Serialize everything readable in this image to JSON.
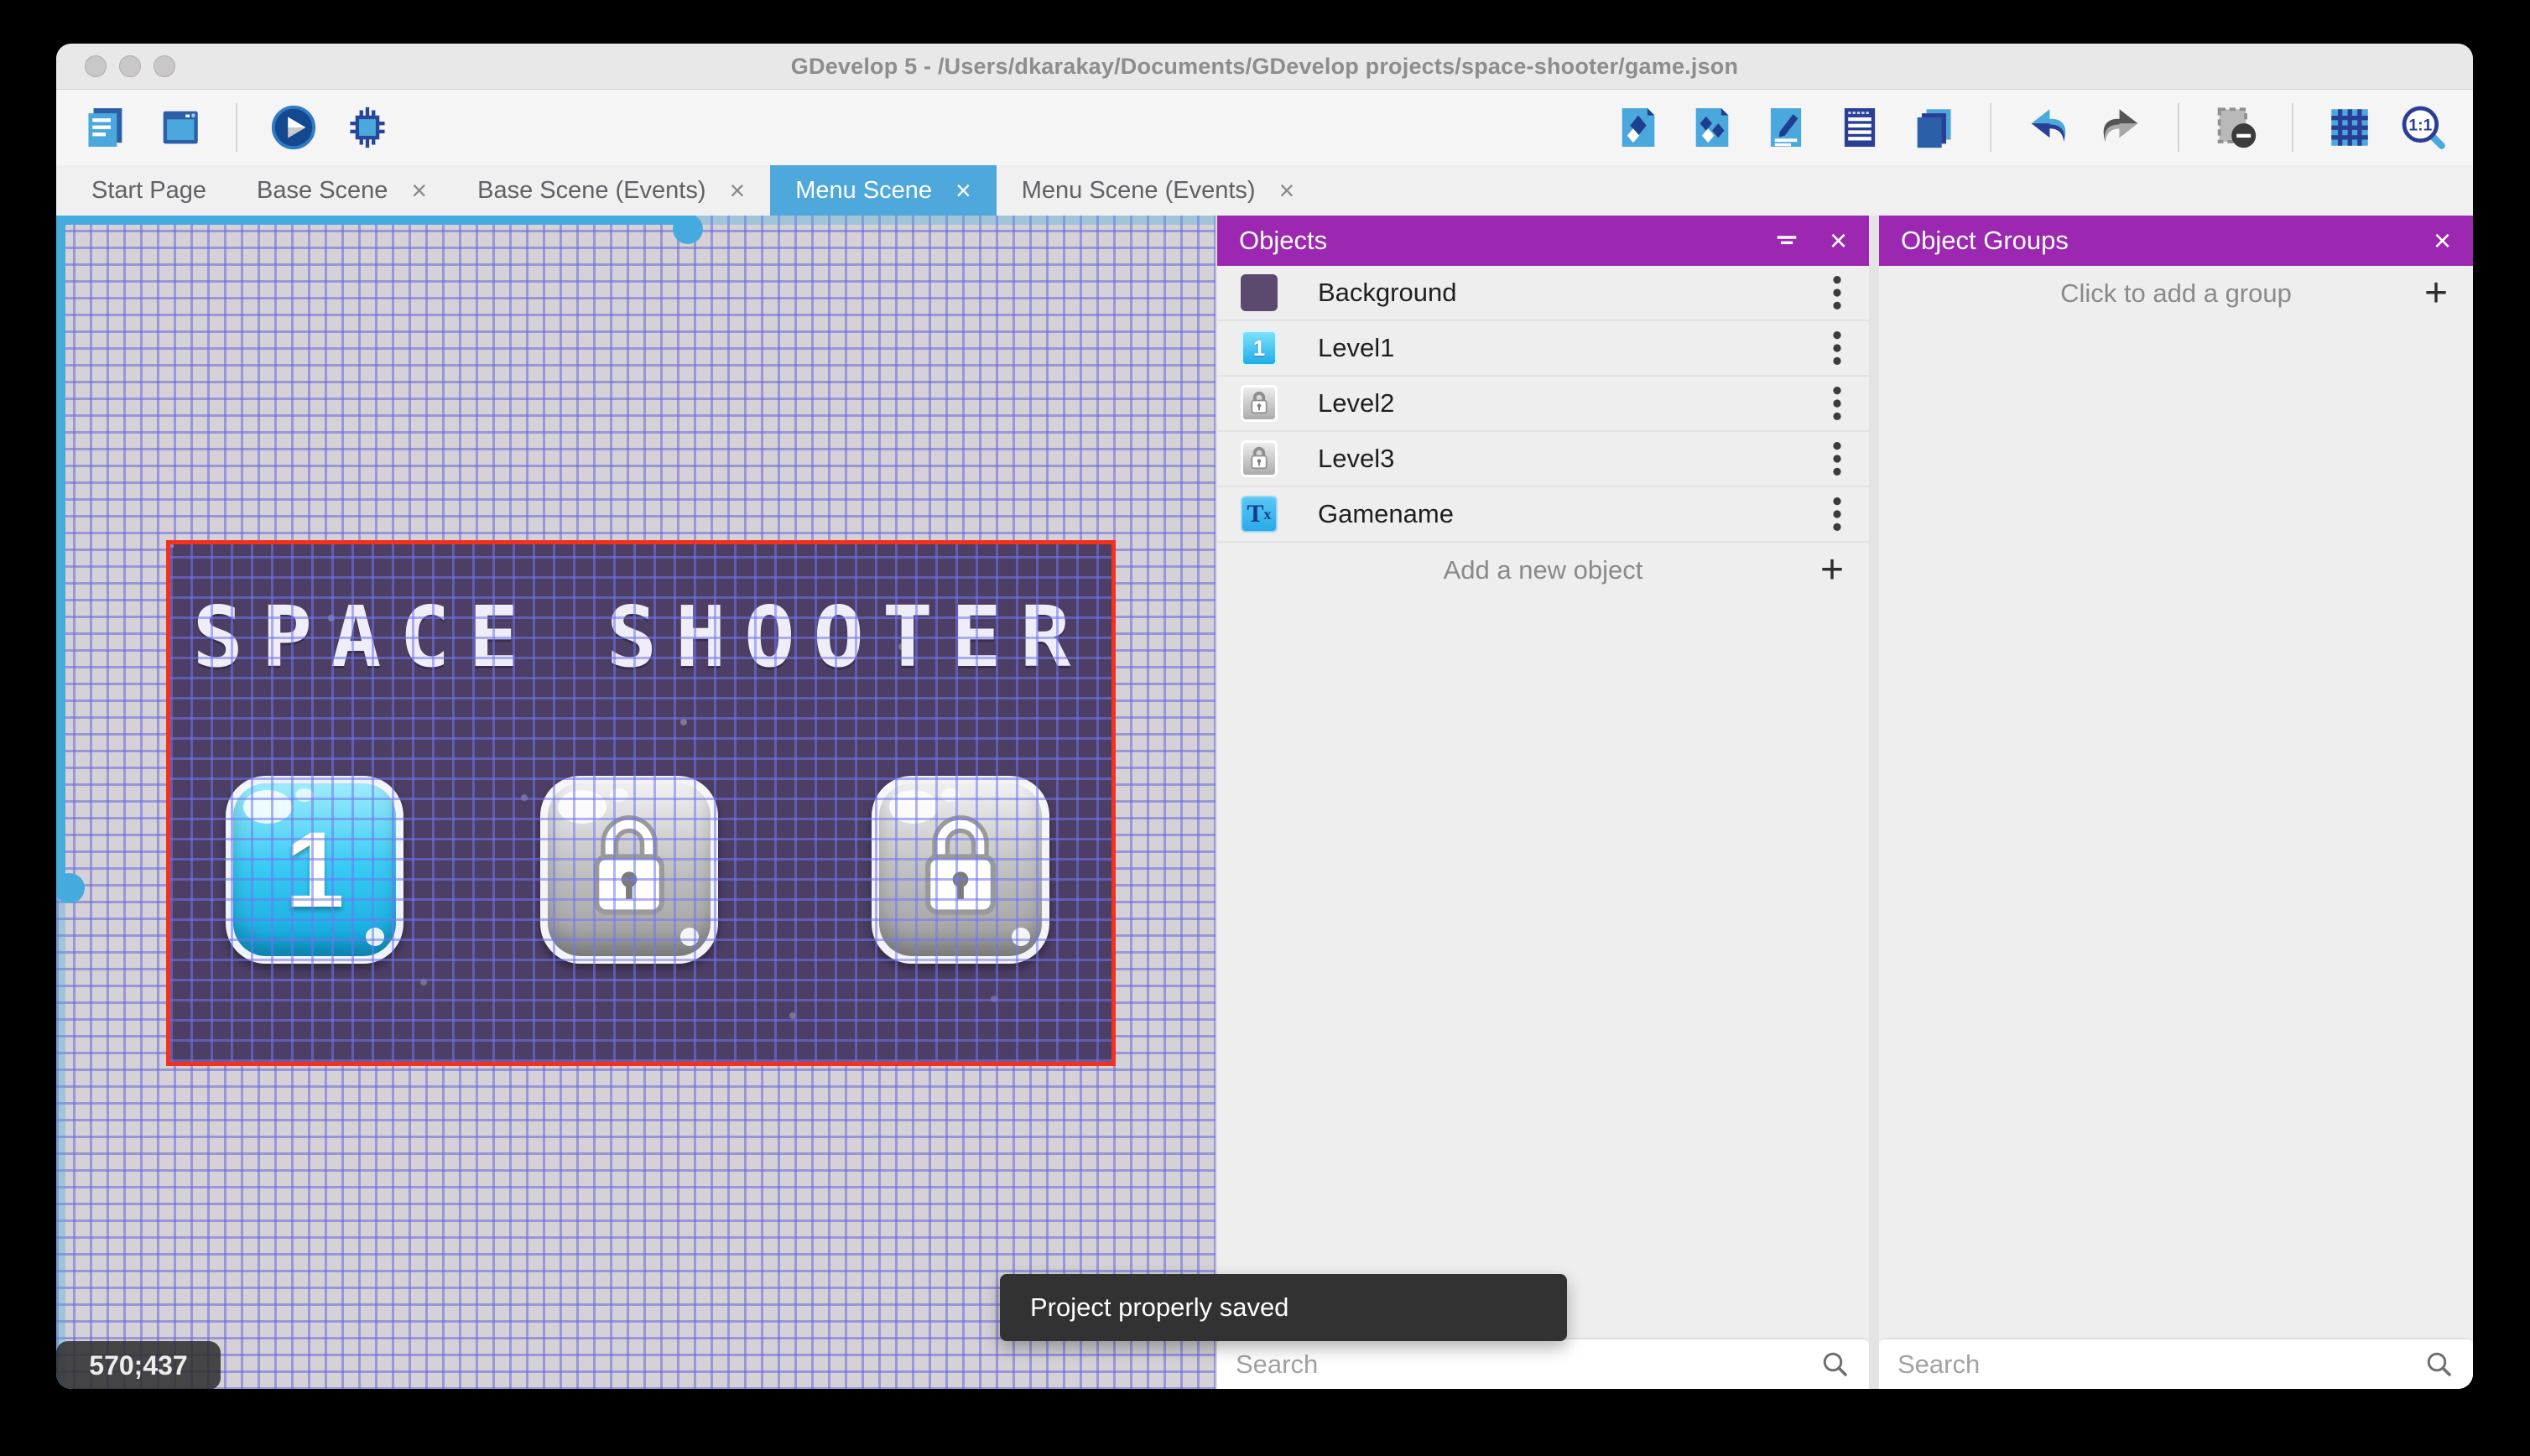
{
  "window": {
    "title": "GDevelop 5 - /Users/dkarakay/Documents/GDevelop projects/space-shooter/game.json"
  },
  "toolbar": {
    "left_icons": [
      "project-manager",
      "scene-editor",
      "preview-play",
      "debug"
    ],
    "right_icons": [
      "objects-panel",
      "object-groups-panel",
      "properties-panel",
      "instances-list-panel",
      "layers-panel",
      "undo",
      "redo",
      "remove-instances",
      "toggle-grid",
      "zoom-1-1"
    ]
  },
  "tabs": [
    {
      "label": "Start Page",
      "active": false,
      "closable": false
    },
    {
      "label": "Base Scene",
      "active": false,
      "closable": true
    },
    {
      "label": "Base Scene (Events)",
      "active": false,
      "closable": true
    },
    {
      "label": "Menu Scene",
      "active": true,
      "closable": true
    },
    {
      "label": "Menu Scene (Events)",
      "active": false,
      "closable": true
    }
  ],
  "canvas": {
    "coordinates": "570;437",
    "scene": {
      "title": "SPACE SHOOTER",
      "level_buttons": [
        {
          "label": "1",
          "state": "unlocked"
        },
        {
          "label": "",
          "state": "locked"
        },
        {
          "label": "",
          "state": "locked"
        }
      ]
    }
  },
  "objects_panel": {
    "title": "Objects",
    "items": [
      {
        "name": "Background",
        "thumb": "purple-background",
        "thumb_label": ""
      },
      {
        "name": "Level1",
        "thumb": "blue-button-1",
        "thumb_label": "1"
      },
      {
        "name": "Level2",
        "thumb": "gray-lock-button",
        "thumb_label": ""
      },
      {
        "name": "Level3",
        "thumb": "gray-lock-button",
        "thumb_label": ""
      },
      {
        "name": "Gamename",
        "thumb": "text-object",
        "thumb_label": "T"
      }
    ],
    "add_label": "Add a new object",
    "search_placeholder": "Search"
  },
  "object_groups_panel": {
    "title": "Object Groups",
    "empty_label": "Click to add a group",
    "search_placeholder": "Search"
  },
  "toast": {
    "message": "Project properly saved"
  },
  "colors": {
    "accent_purple": "#9C27B0",
    "accent_blue": "#4FA8DC",
    "selection_red": "#F5311D",
    "scene_background": "#4C3E65",
    "grid_line": "#6A66DB"
  }
}
